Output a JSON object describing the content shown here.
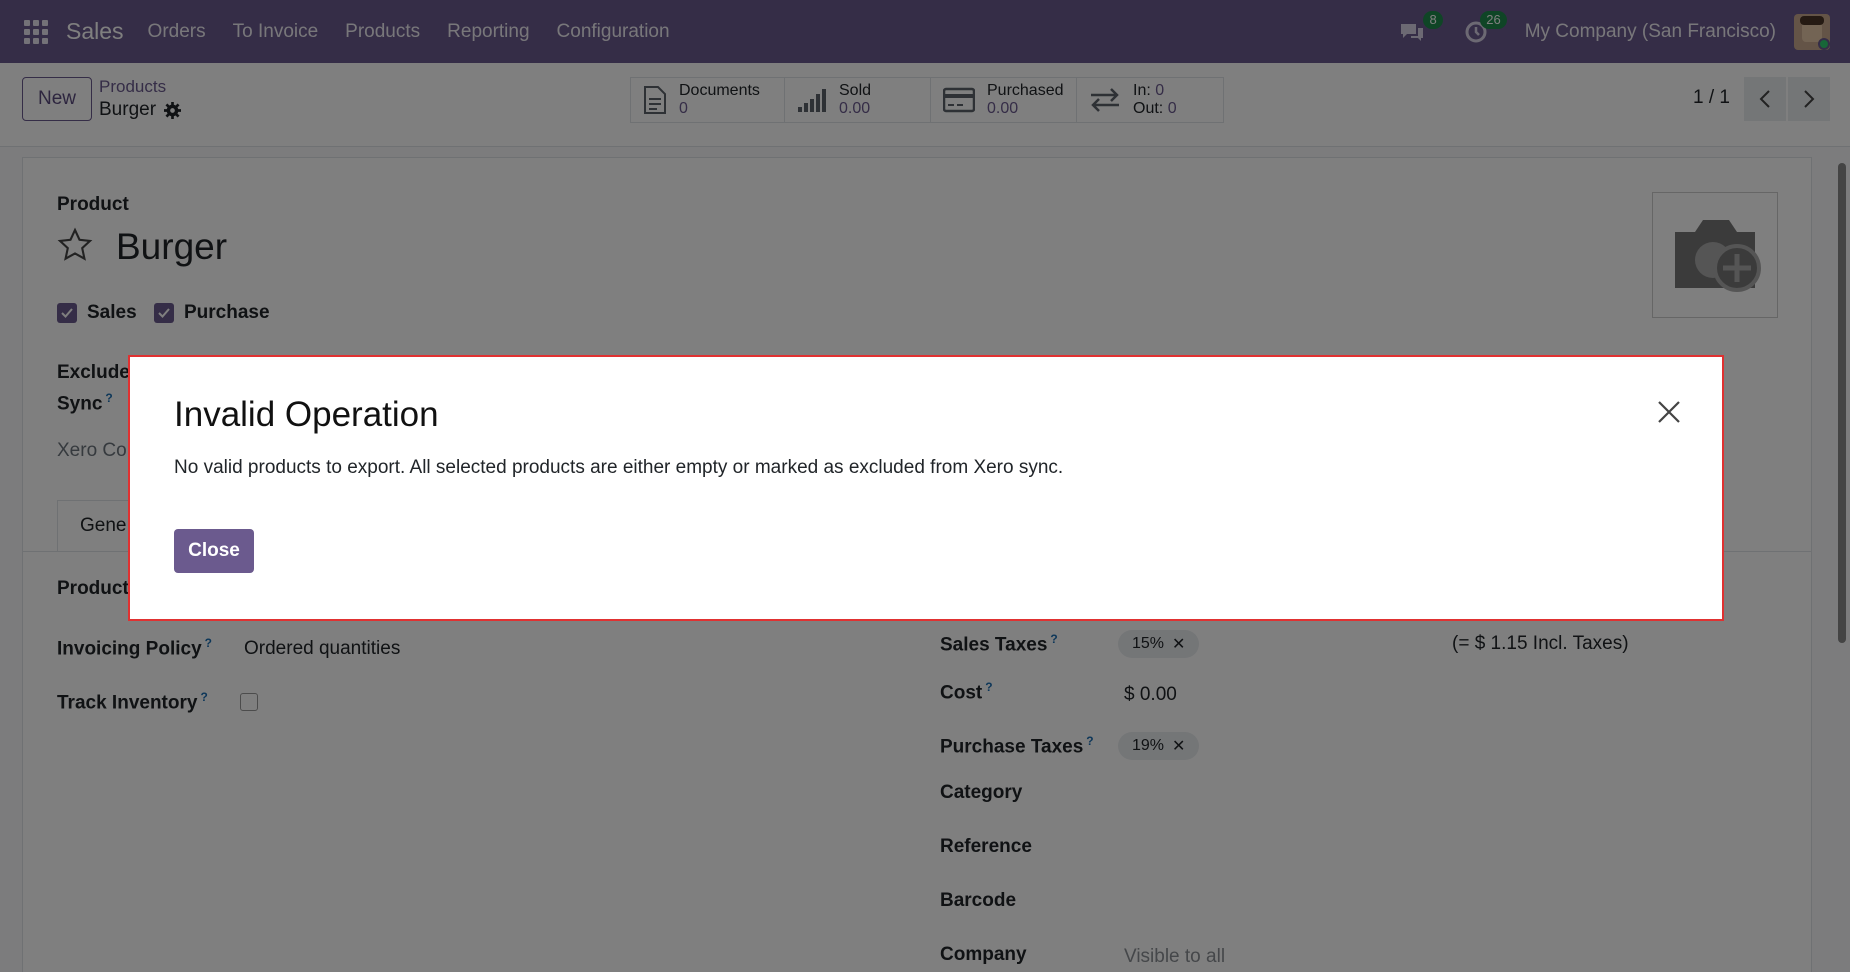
{
  "navbar": {
    "brand": "Sales",
    "menu": [
      "Orders",
      "To Invoice",
      "Products",
      "Reporting",
      "Configuration"
    ],
    "messages_count": "8",
    "activities_count": "26",
    "company": "My Company (San Francisco)",
    "accent_color": "#6b5a8e"
  },
  "control_panel": {
    "new_label": "New",
    "breadcrumb_parent": "Products",
    "breadcrumb_current": "Burger",
    "smart_buttons": [
      {
        "label": "Documents",
        "value": "0",
        "icon": "document-icon"
      },
      {
        "label": "Sold",
        "value": "0.00",
        "icon": "signal-chart-icon"
      },
      {
        "label": "Purchased",
        "value": "0.00",
        "icon": "credit-card-icon"
      },
      {
        "label": "In:",
        "value": "0",
        "label2": "Out:",
        "value2": "0",
        "icon": "transfer-arrows-icon"
      }
    ],
    "pager": "1 / 1"
  },
  "form": {
    "product_label": "Product",
    "product_name": "Burger",
    "sales_label": "Sales",
    "purchase_label": "Purchase",
    "exclude_label": "Exclude",
    "sync_label": "Sync",
    "xero_label": "Xero Co",
    "tab_general": "Gene",
    "product_type_label": "Product",
    "invoicing_policy_label": "Invoicing Policy",
    "invoicing_policy_value": "Ordered quantities",
    "track_inventory_label": "Track Inventory",
    "sales_taxes_label": "Sales Taxes",
    "sales_taxes_tag": "15%",
    "incl_taxes": "(= $ 1.15 Incl. Taxes)",
    "cost_label": "Cost",
    "cost_value": "$ 0.00",
    "purchase_taxes_label": "Purchase Taxes",
    "purchase_taxes_tag": "19%",
    "category_label": "Category",
    "reference_label": "Reference",
    "barcode_label": "Barcode",
    "company_label": "Company",
    "company_placeholder": "Visible to all",
    "help_mark": "?"
  },
  "modal": {
    "title": "Invalid Operation",
    "body": "No valid products to export. All selected products are either empty or marked as excluded from Xero sync.",
    "close_label": "Close"
  }
}
